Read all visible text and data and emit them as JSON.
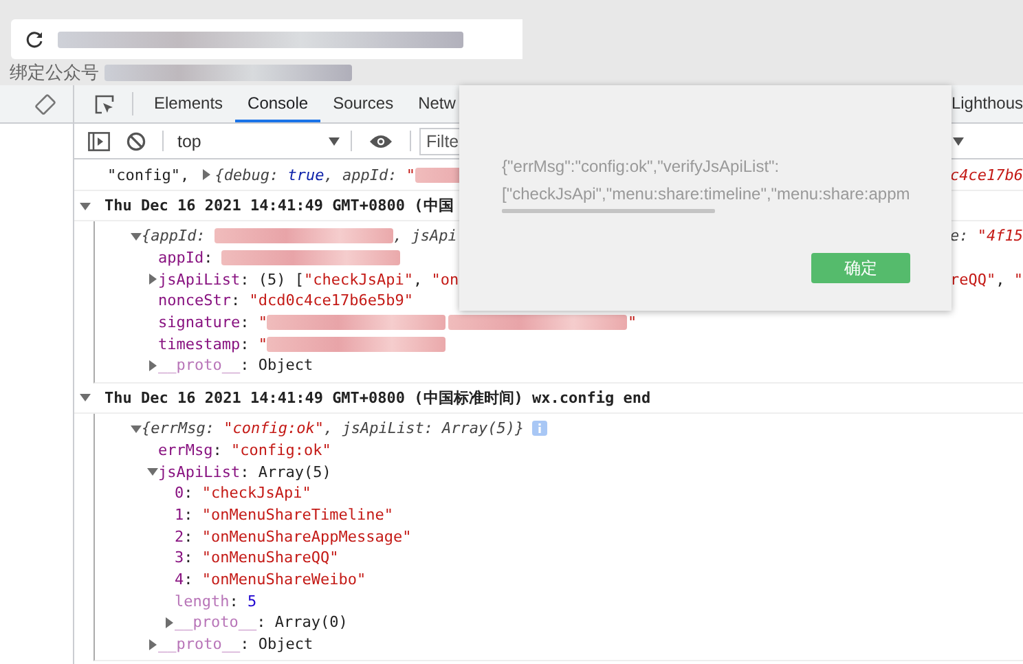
{
  "page": {
    "heading": "绑定公众号"
  },
  "devtools": {
    "tabs": [
      {
        "label": "Elements",
        "selected": false
      },
      {
        "label": "Console",
        "selected": true
      },
      {
        "label": "Sources",
        "selected": false
      },
      {
        "label": "Netw",
        "selected": false
      },
      {
        "label": "Lighthous",
        "selected": false
      }
    ],
    "context": "top",
    "filter_placeholder": "Filte"
  },
  "console": [
    {
      "kind": "entry",
      "parts": [
        {
          "kind": "plain",
          "text": "\"config\", "
        },
        {
          "kind": "toggle",
          "expanded": false
        },
        {
          "kind": "preview",
          "text": "{debug: "
        },
        {
          "kind": "keyword",
          "text": "true"
        },
        {
          "kind": "preview",
          "text": ", appId: "
        },
        {
          "kind": "pstring",
          "text": "\""
        },
        {
          "kind": "redacted"
        }
      ],
      "right": [
        {
          "kind": "pstring",
          "text": "c4ce17b6"
        }
      ]
    },
    {
      "kind": "group",
      "expanded": true,
      "parts": [
        {
          "kind": "plain",
          "text": "Thu Dec 16 2021 14:41:49 GMT+0800 (中国"
        }
      ],
      "children": [
        {
          "expanded": true,
          "parts": [
            {
              "kind": "preview",
              "text": "{appId: "
            },
            {
              "kind": "redacted"
            },
            {
              "kind": "preview",
              "text": ", jsApi"
            }
          ],
          "right": [
            {
              "kind": "preview",
              "text": "e: "
            },
            {
              "kind": "pstring",
              "text": "\"4f15"
            }
          ],
          "children": [
            {
              "parts": [
                {
                  "kind": "key",
                  "text": "appId"
                },
                {
                  "kind": "plain",
                  "text": ": "
                },
                {
                  "kind": "redacted"
                }
              ]
            },
            {
              "expanded": false,
              "parts": [
                {
                  "kind": "key",
                  "text": "jsApiList"
                },
                {
                  "kind": "plain",
                  "text": ": (5) ["
                },
                {
                  "kind": "string",
                  "text": "\"checkJsApi\""
                },
                {
                  "kind": "plain",
                  "text": ", "
                },
                {
                  "kind": "string",
                  "text": "\"on"
                }
              ],
              "right": [
                {
                  "kind": "string",
                  "text": "reQQ\""
                },
                {
                  "kind": "plain",
                  "text": ", "
                },
                {
                  "kind": "string",
                  "text": "\""
                }
              ]
            },
            {
              "parts": [
                {
                  "kind": "key",
                  "text": "nonceStr"
                },
                {
                  "kind": "plain",
                  "text": ": "
                },
                {
                  "kind": "string",
                  "text": "\"dcd0c4ce17b6e5b9\""
                }
              ]
            },
            {
              "parts": [
                {
                  "kind": "key",
                  "text": "signature"
                },
                {
                  "kind": "plain",
                  "text": ": "
                },
                {
                  "kind": "string",
                  "text": "\""
                },
                {
                  "kind": "redacted"
                },
                {
                  "kind": "redacted"
                },
                {
                  "kind": "string",
                  "text": "\""
                }
              ]
            },
            {
              "parts": [
                {
                  "kind": "key",
                  "text": "timestamp"
                },
                {
                  "kind": "plain",
                  "text": ": "
                },
                {
                  "kind": "string",
                  "text": "\""
                },
                {
                  "kind": "redacted"
                }
              ]
            },
            {
              "expanded": false,
              "parts": [
                {
                  "kind": "dimkey",
                  "text": "__proto__"
                },
                {
                  "kind": "plain",
                  "text": ": Object"
                }
              ]
            }
          ]
        }
      ]
    },
    {
      "kind": "group",
      "expanded": true,
      "parts": [
        {
          "kind": "plain",
          "text": "Thu Dec 16 2021 14:41:49 GMT+0800 (中国标准时间) wx.config end"
        }
      ],
      "children": [
        {
          "expanded": true,
          "info": true,
          "parts": [
            {
              "kind": "preview",
              "text": "{errMsg: "
            },
            {
              "kind": "pstring",
              "text": "\"config:ok\""
            },
            {
              "kind": "preview",
              "text": ", jsApiList: Array(5)}"
            }
          ],
          "children": [
            {
              "parts": [
                {
                  "kind": "key",
                  "text": "errMsg"
                },
                {
                  "kind": "plain",
                  "text": ": "
                },
                {
                  "kind": "string",
                  "text": "\"config:ok\""
                }
              ]
            },
            {
              "expanded": true,
              "parts": [
                {
                  "kind": "key",
                  "text": "jsApiList"
                },
                {
                  "kind": "plain",
                  "text": ": Array(5)"
                }
              ],
              "children": [
                {
                  "parts": [
                    {
                      "kind": "key",
                      "text": "0"
                    },
                    {
                      "kind": "plain",
                      "text": ": "
                    },
                    {
                      "kind": "string",
                      "text": "\"checkJsApi\""
                    }
                  ]
                },
                {
                  "parts": [
                    {
                      "kind": "key",
                      "text": "1"
                    },
                    {
                      "kind": "plain",
                      "text": ": "
                    },
                    {
                      "kind": "string",
                      "text": "\"onMenuShareTimeline\""
                    }
                  ]
                },
                {
                  "parts": [
                    {
                      "kind": "key",
                      "text": "2"
                    },
                    {
                      "kind": "plain",
                      "text": ": "
                    },
                    {
                      "kind": "string",
                      "text": "\"onMenuShareAppMessage\""
                    }
                  ]
                },
                {
                  "parts": [
                    {
                      "kind": "key",
                      "text": "3"
                    },
                    {
                      "kind": "plain",
                      "text": ": "
                    },
                    {
                      "kind": "string",
                      "text": "\"onMenuShareQQ\""
                    }
                  ]
                },
                {
                  "parts": [
                    {
                      "kind": "key",
                      "text": "4"
                    },
                    {
                      "kind": "plain",
                      "text": ": "
                    },
                    {
                      "kind": "string",
                      "text": "\"onMenuShareWeibo\""
                    }
                  ]
                },
                {
                  "parts": [
                    {
                      "kind": "dimkey",
                      "text": "length"
                    },
                    {
                      "kind": "plain",
                      "text": ": "
                    },
                    {
                      "kind": "number",
                      "text": "5"
                    }
                  ]
                },
                {
                  "expanded": false,
                  "parts": [
                    {
                      "kind": "dimkey",
                      "text": "__proto__"
                    },
                    {
                      "kind": "plain",
                      "text": ": Array(0)"
                    }
                  ]
                }
              ]
            },
            {
              "expanded": false,
              "parts": [
                {
                  "kind": "dimkey",
                  "text": "__proto__"
                },
                {
                  "kind": "plain",
                  "text": ": Object"
                }
              ]
            }
          ]
        }
      ]
    }
  ],
  "dialog": {
    "message_lines": [
      "{\"errMsg\":\"config:ok\",\"verifyJsApiList\":",
      "[\"checkJsApi\",\"menu:share:timeline\",\"menu:share:appm"
    ],
    "button": "确定"
  }
}
